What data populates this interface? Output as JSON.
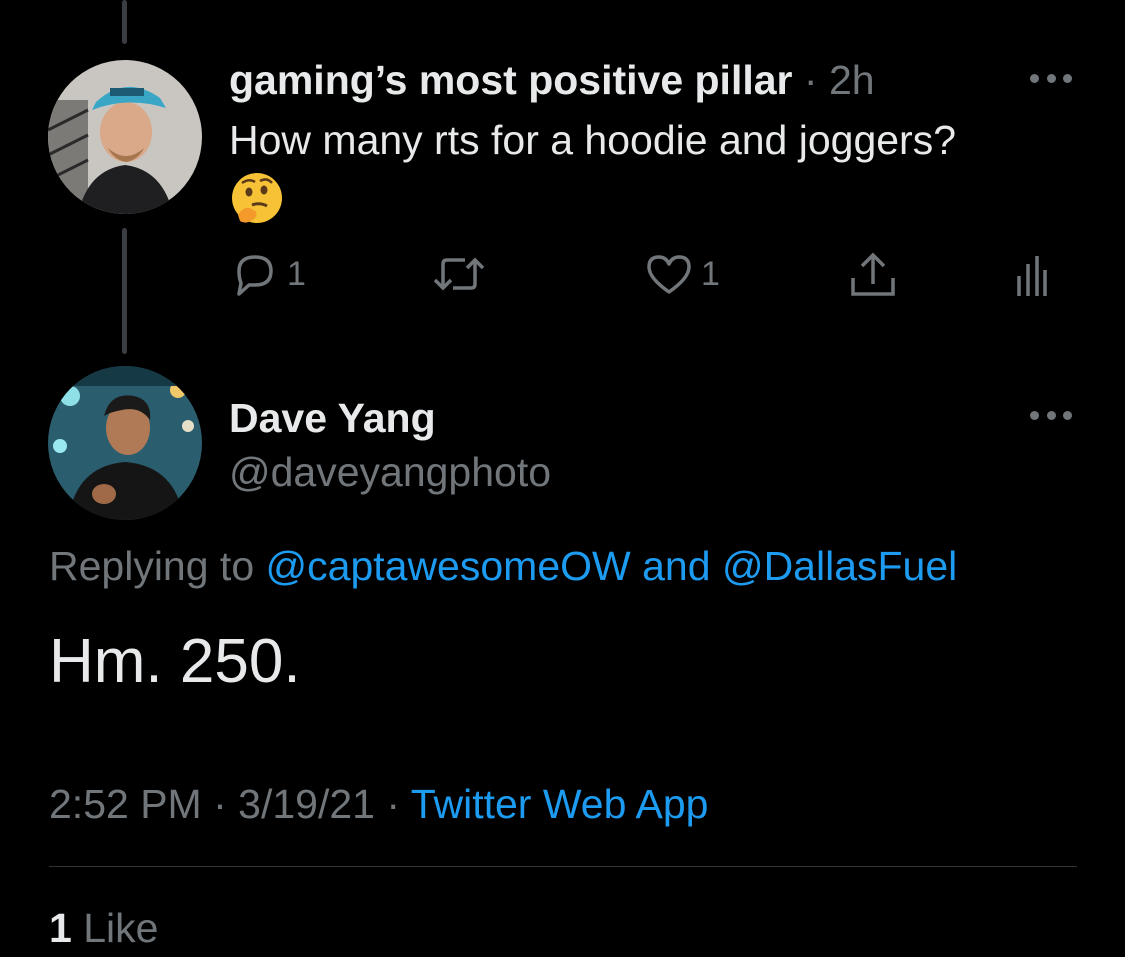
{
  "parent_tweet": {
    "display_name": "gaming’s most positive pillar",
    "separator": "·",
    "time_ago": "2h",
    "text": "How many rts for a hoodie and joggers?",
    "emoji": "thinking-face",
    "actions": {
      "reply_count": "1",
      "retweet_count": "",
      "like_count": "1"
    },
    "icons": [
      "reply-icon",
      "retweet-icon",
      "like-icon",
      "share-icon",
      "analytics-icon",
      "more-icon"
    ]
  },
  "reply_tweet": {
    "display_name": "Dave Yang",
    "handle": "@daveyangphoto",
    "replying_prefix": "Replying to",
    "replying_user_1": "@captawesomeOW",
    "replying_and": "and",
    "replying_user_2": "@DallasFuel",
    "text": "Hm. 250.",
    "time": "2:52 PM",
    "date": "3/19/21",
    "dot": "·",
    "source": "Twitter Web App",
    "like_count": "1",
    "like_label": "Like"
  },
  "colors": {
    "background": "#000000",
    "text_primary": "#e7e9ea",
    "text_muted": "#71767b",
    "link": "#1d9bf0",
    "divider": "#2f3336"
  }
}
